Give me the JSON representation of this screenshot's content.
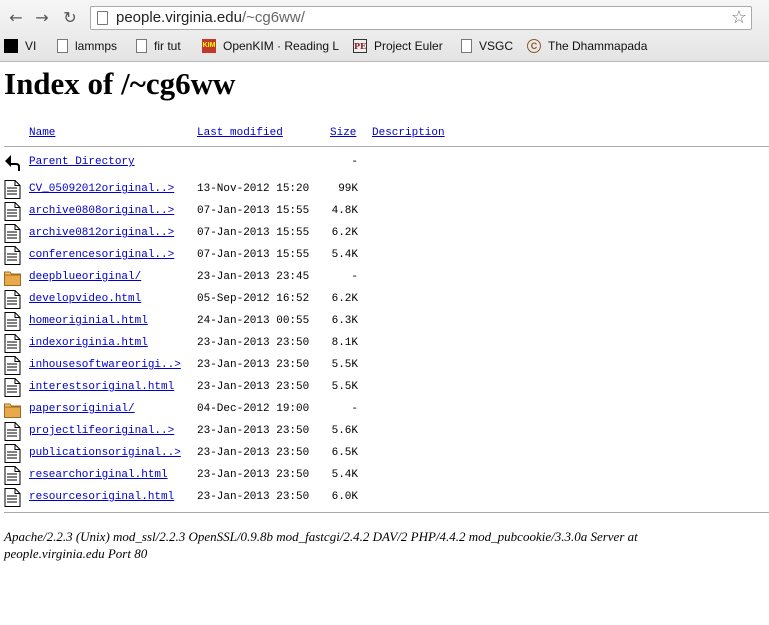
{
  "browser": {
    "url_host": "people.virginia.edu",
    "url_path": "/~cg6ww/",
    "bookmarks": [
      {
        "label": "VI",
        "icon": "black-square-icon"
      },
      {
        "label": "lammps",
        "icon": "page-icon"
      },
      {
        "label": "fir tut",
        "icon": "page-icon"
      },
      {
        "label": "OpenKIM · Reading L",
        "icon": "openkim-icon",
        "badge": "KIM"
      },
      {
        "label": "Project Euler",
        "icon": "project-euler-icon",
        "badge": "PE"
      },
      {
        "label": "VSGC",
        "icon": "page-icon"
      },
      {
        "label": "The Dhammapada",
        "icon": "dhammapada-icon",
        "badge": "C"
      }
    ]
  },
  "page": {
    "title": "Index of /~cg6ww",
    "columns": {
      "name": "Name",
      "last_modified": "Last modified",
      "size": "Size",
      "description": "Description"
    },
    "rows": [
      {
        "name": "Parent Directory",
        "date": "",
        "size": "-",
        "icon": "back-arrow-icon"
      },
      {
        "name": "CV_05092012original..>",
        "date": "13-Nov-2012 15:20",
        "size": "99K",
        "icon": "file-icon"
      },
      {
        "name": "archive0808original..>",
        "date": "07-Jan-2013 15:55",
        "size": "4.8K",
        "icon": "file-icon"
      },
      {
        "name": "archive0812original..>",
        "date": "07-Jan-2013 15:55",
        "size": "6.2K",
        "icon": "file-icon"
      },
      {
        "name": "conferencesoriginal..>",
        "date": "07-Jan-2013 15:55",
        "size": "5.4K",
        "icon": "file-icon"
      },
      {
        "name": "deepblueoriginal/",
        "date": "23-Jan-2013 23:45",
        "size": "-",
        "icon": "folder-icon"
      },
      {
        "name": "developvideo.html",
        "date": "05-Sep-2012 16:52",
        "size": "6.2K",
        "icon": "file-icon"
      },
      {
        "name": "homeoriginial.html",
        "date": "24-Jan-2013 00:55",
        "size": "6.3K",
        "icon": "file-icon"
      },
      {
        "name": "indexoriginia.html",
        "date": "23-Jan-2013 23:50",
        "size": "8.1K",
        "icon": "file-icon"
      },
      {
        "name": "inhousesoftwareorigi..>",
        "date": "23-Jan-2013 23:50",
        "size": "5.5K",
        "icon": "file-icon"
      },
      {
        "name": "interestsoriginal.html",
        "date": "23-Jan-2013 23:50",
        "size": "5.5K",
        "icon": "file-icon"
      },
      {
        "name": "papersoriginial/",
        "date": "04-Dec-2012 19:00",
        "size": "-",
        "icon": "folder-icon"
      },
      {
        "name": "projectlifeoriginal..>",
        "date": "23-Jan-2013 23:50",
        "size": "5.6K",
        "icon": "file-icon"
      },
      {
        "name": "publicationsoriginal..>",
        "date": "23-Jan-2013 23:50",
        "size": "6.5K",
        "icon": "file-icon"
      },
      {
        "name": "researchoriginal.html",
        "date": "23-Jan-2013 23:50",
        "size": "5.4K",
        "icon": "file-icon"
      },
      {
        "name": "resourcesoriginal.html",
        "date": "23-Jan-2013 23:50",
        "size": "6.0K",
        "icon": "file-icon"
      }
    ],
    "address_line1": "Apache/2.2.3 (Unix) mod_ssl/2.2.3 OpenSSL/0.9.8b mod_fastcgi/2.4.2 DAV/2 PHP/4.4.2 mod_pubcookie/3.3.0a Server at",
    "address_line2": "people.virginia.edu Port 80"
  }
}
